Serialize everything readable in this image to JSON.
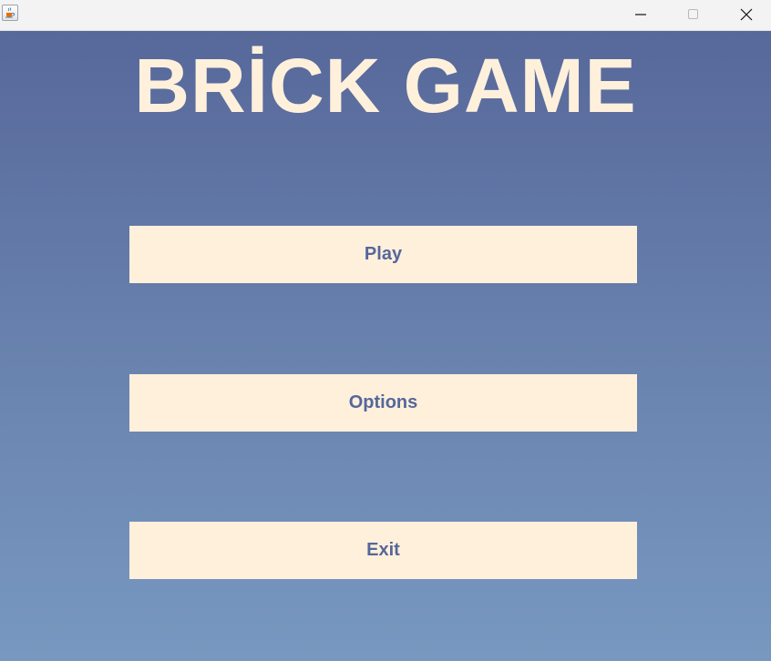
{
  "window": {
    "icon": "java-cup-icon",
    "controls": {
      "minimize_icon": "minimize-icon",
      "maximize_icon": "maximize-icon",
      "close_icon": "close-icon"
    }
  },
  "game": {
    "title": "BRİCK GAME"
  },
  "menu": {
    "play_label": "Play",
    "options_label": "Options",
    "exit_label": "Exit"
  },
  "colors": {
    "background_top": "#57689a",
    "background_bottom": "#7898c0",
    "title_text": "#fff0dc",
    "button_background": "#fff0dc",
    "button_text": "#55679a"
  }
}
